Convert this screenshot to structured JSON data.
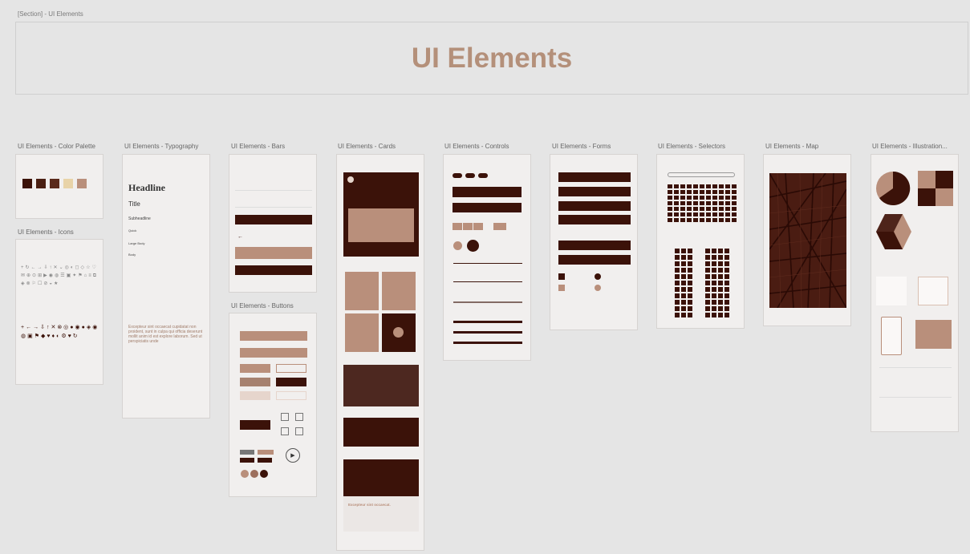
{
  "section_label": "[Section] - UI Elements",
  "hero_title": "UI Elements",
  "frames": {
    "color_palette": "UI Elements - Color Palette",
    "typography": "UI Elements - Typography",
    "bars": "UI Elements - Bars",
    "cards": "UI Elements - Cards",
    "controls": "UI Elements - Controls",
    "forms": "UI Elements - Forms",
    "selectors": "UI Elements - Selectors",
    "map": "UI Elements - Map",
    "illustration": "UI Elements - Illustration...",
    "icons": "UI Elements - Icons",
    "buttons": "UI Elements - Buttons"
  },
  "typography": {
    "headline": "Headline",
    "title": "Title",
    "subheadline": "Subheadline",
    "quick": "Quick",
    "large_body": "Large Body",
    "body": "Body",
    "paragraph": "Excepteur sint occaecat cupidatat non proident, sunt in culpa qui officia deserunt mollit anim id est explore laborum. Sed ut perspiciatis unde"
  },
  "cards": {
    "card_title": "Excepteur sint occaecat."
  },
  "colors": {
    "dark": "#3b1209",
    "tan": "#b98f7b",
    "light": "#e6d5cc",
    "hero_text": "#b4907a"
  }
}
